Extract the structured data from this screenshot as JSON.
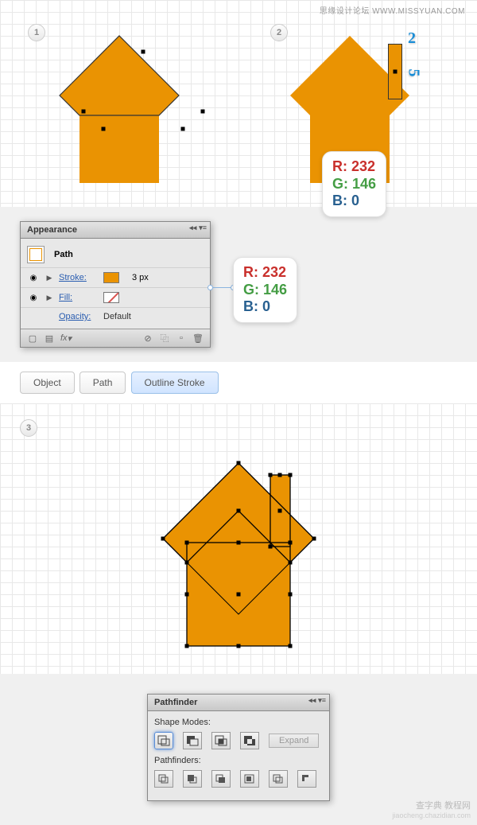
{
  "header": {
    "watermark": "思缘设计论坛  WWW.MISSYUAN.COM"
  },
  "steps": {
    "s1": "1",
    "s2": "2",
    "s3": "3"
  },
  "chimney": {
    "w": "2",
    "h": "5"
  },
  "rgb": {
    "r_label": "R: 232",
    "g_label": "G: 146",
    "b_label": "B: 0"
  },
  "appearance_panel": {
    "title": "Appearance",
    "path_label": "Path",
    "stroke_label": "Stroke:",
    "stroke_value": "3 px",
    "fill_label": "Fill:",
    "opacity_label": "Opacity:",
    "opacity_value": "Default",
    "fx_label": "fx"
  },
  "breadcrumb": {
    "object": "Object",
    "path": "Path",
    "outline": "Outline Stroke"
  },
  "pathfinder_panel": {
    "title": "Pathfinder",
    "shape_modes": "Shape Modes:",
    "expand": "Expand",
    "pathfinders": "Pathfinders:"
  },
  "footer": {
    "wm1": "查字典 教程网",
    "wm2": "jiaocheng.chazidian.com"
  }
}
